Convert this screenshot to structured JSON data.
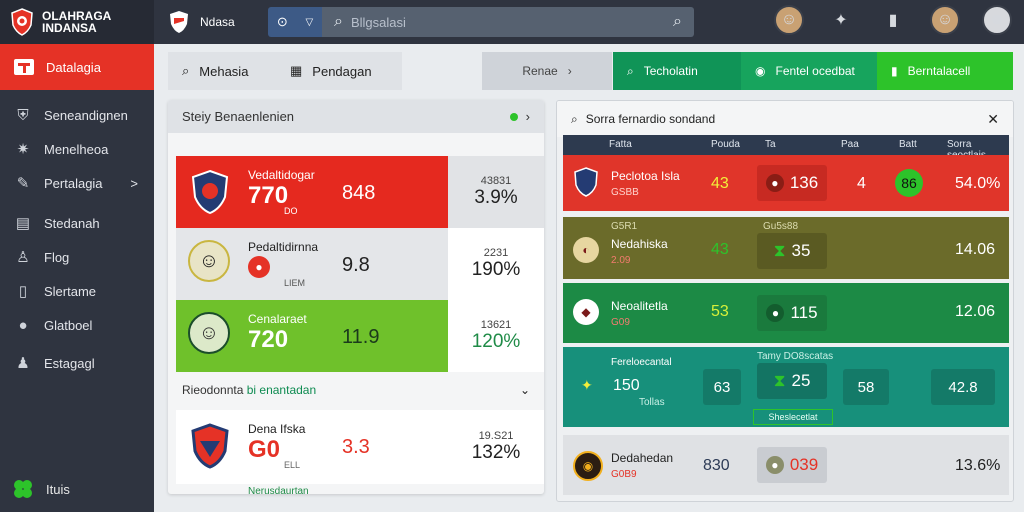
{
  "app": {
    "title": "OLAHRAGA",
    "subtitle": "INDANSA",
    "brand": "Ndasa"
  },
  "search": {
    "placeholder": "Bllgsalasi"
  },
  "sidebar": {
    "active": "Datalagia",
    "items": [
      {
        "label": "Seneandignen",
        "icon": "shield-icon"
      },
      {
        "label": "Menelheoa",
        "icon": "sports-icon"
      },
      {
        "label": "Pertalagia",
        "icon": "pen-icon",
        "chevron": ">"
      },
      {
        "label": "Stedanah",
        "icon": "doc-icon"
      },
      {
        "label": "Flog",
        "icon": "user-icon"
      },
      {
        "label": "Slertame",
        "icon": "file-icon"
      },
      {
        "label": "Glatboel",
        "icon": "ball-icon"
      },
      {
        "label": "Estagagl",
        "icon": "group-icon"
      }
    ],
    "bottom": "Ituis"
  },
  "toolbar": {
    "search_label": "Mehasia",
    "calendar_label": "Pendagan",
    "filter_label": "Renae",
    "green1": "Techolatin",
    "green2": "Fentel ocedbat",
    "green3": "Berntalacell"
  },
  "left_panel": {
    "title": "Steiy Benaenlenien",
    "rows": [
      {
        "name": "Vedaltidogar",
        "score": "770",
        "sub": "DO",
        "mid": "848",
        "pct_small": "43831",
        "pct": "3.9%"
      },
      {
        "name": "Pedaltidirnna",
        "score": "",
        "sub": "LIEM",
        "mid": "9.8",
        "pct_small": "2231",
        "pct": "190%"
      },
      {
        "name": "Cenalaraet",
        "score": "720",
        "sub": "",
        "mid": "11.9",
        "pct_small": "13621",
        "pct": "120%"
      }
    ],
    "section_title": "Rieodonnta",
    "section_title_accent": "bi enantadan",
    "bottom_row": {
      "name": "Dena Ifska",
      "score": "G0",
      "sub": "ELL",
      "mid": "3.3",
      "pct_small": "19.S21",
      "pct": "132%"
    },
    "tail": "Nerusdaurtan"
  },
  "right_panel": {
    "title": "Sorra fernardio sondand",
    "columns": [
      "Fatta",
      "Pouda",
      "Ta",
      "Paa",
      "Batt",
      "Sorra seoctlais"
    ],
    "rows": [
      {
        "name": "Peclotoa Isla",
        "sub": "GSBB",
        "a": "43",
        "b": "136",
        "c": "4",
        "d": "86",
        "e": "54.0%"
      },
      {
        "name": "Nedahiska",
        "pre": "G5R1",
        "pre2": "Gu5s88",
        "sub": "2.09",
        "a": "43",
        "b": "35",
        "e": "14.06"
      },
      {
        "name": "Neoalitetla",
        "sub": "G09",
        "a": "53",
        "b": "115",
        "e": "12.06"
      },
      {
        "name": "Fereloecantal",
        "tag": "Tamy DO8scatas",
        "sub": "Tollas",
        "a": "150",
        "b": "63",
        "c": "25",
        "d": "58",
        "e": "42.8",
        "button": "Sheslecetlat"
      },
      {
        "name": "Dedahedan",
        "sub": "G0B9",
        "a": "830",
        "b": "039",
        "e": "13.6%"
      }
    ]
  },
  "colors": {
    "red": "#e53226",
    "green": "#2dc32a",
    "teal": "#17907b",
    "dark": "#2f3440"
  }
}
